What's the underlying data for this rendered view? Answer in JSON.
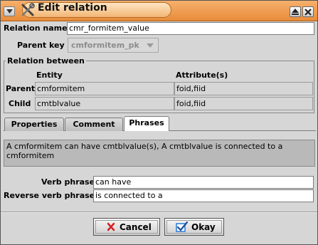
{
  "window": {
    "title": "Edit relation"
  },
  "form": {
    "relation_name_label": "Relation name",
    "relation_name_value": "cmr_formitem_value",
    "parent_key_label": "Parent key",
    "parent_key_value": "cmformitem_pk"
  },
  "relation_between": {
    "title": "Relation between",
    "col_entity": "Entity",
    "col_attributes": "Attribute(s)",
    "rows": [
      {
        "role": "Parent",
        "entity": "cmformitem",
        "attributes": "foid,fiid"
      },
      {
        "role": "Child",
        "entity": "cmtblvalue",
        "attributes": "foid,fiid"
      }
    ]
  },
  "tabs": [
    {
      "label": "Properties",
      "active": false
    },
    {
      "label": "Comment",
      "active": false
    },
    {
      "label": "Phrases",
      "active": true
    }
  ],
  "phrases": {
    "description": "A cmformitem can have cmtblvalue(s), A cmtblvalue is connected to a cmformitem",
    "verb_phrase_label": "Verb phrase",
    "verb_phrase_value": "can have",
    "reverse_verb_phrase_label": "Reverse verb phrase",
    "reverse_verb_phrase_value": "is connected to a"
  },
  "buttons": {
    "cancel": "Cancel",
    "okay": "Okay"
  },
  "icons": {
    "menu": "window-menu-icon",
    "title": "tools-icon",
    "shade": "shade-icon",
    "close": "close-icon",
    "cancel": "red-x-icon",
    "okay": "check-icon"
  },
  "colors": {
    "titlebar": "#e98c3a",
    "cancel_icon": "#d42020",
    "okay_icon": "#2a7ad8"
  }
}
